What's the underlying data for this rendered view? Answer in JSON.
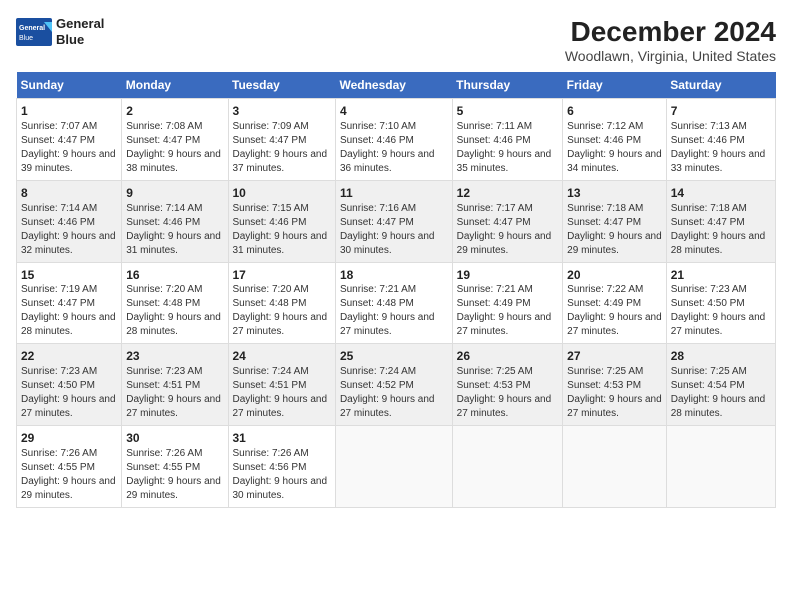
{
  "logo": {
    "line1": "General",
    "line2": "Blue"
  },
  "title": "December 2024",
  "subtitle": "Woodlawn, Virginia, United States",
  "headers": [
    "Sunday",
    "Monday",
    "Tuesday",
    "Wednesday",
    "Thursday",
    "Friday",
    "Saturday"
  ],
  "weeks": [
    [
      {
        "day": 1,
        "sunrise": "7:07 AM",
        "sunset": "4:47 PM",
        "daylight": "9 hours and 39 minutes."
      },
      {
        "day": 2,
        "sunrise": "7:08 AM",
        "sunset": "4:47 PM",
        "daylight": "9 hours and 38 minutes."
      },
      {
        "day": 3,
        "sunrise": "7:09 AM",
        "sunset": "4:47 PM",
        "daylight": "9 hours and 37 minutes."
      },
      {
        "day": 4,
        "sunrise": "7:10 AM",
        "sunset": "4:46 PM",
        "daylight": "9 hours and 36 minutes."
      },
      {
        "day": 5,
        "sunrise": "7:11 AM",
        "sunset": "4:46 PM",
        "daylight": "9 hours and 35 minutes."
      },
      {
        "day": 6,
        "sunrise": "7:12 AM",
        "sunset": "4:46 PM",
        "daylight": "9 hours and 34 minutes."
      },
      {
        "day": 7,
        "sunrise": "7:13 AM",
        "sunset": "4:46 PM",
        "daylight": "9 hours and 33 minutes."
      }
    ],
    [
      {
        "day": 8,
        "sunrise": "7:14 AM",
        "sunset": "4:46 PM",
        "daylight": "9 hours and 32 minutes."
      },
      {
        "day": 9,
        "sunrise": "7:14 AM",
        "sunset": "4:46 PM",
        "daylight": "9 hours and 31 minutes."
      },
      {
        "day": 10,
        "sunrise": "7:15 AM",
        "sunset": "4:46 PM",
        "daylight": "9 hours and 31 minutes."
      },
      {
        "day": 11,
        "sunrise": "7:16 AM",
        "sunset": "4:47 PM",
        "daylight": "9 hours and 30 minutes."
      },
      {
        "day": 12,
        "sunrise": "7:17 AM",
        "sunset": "4:47 PM",
        "daylight": "9 hours and 29 minutes."
      },
      {
        "day": 13,
        "sunrise": "7:18 AM",
        "sunset": "4:47 PM",
        "daylight": "9 hours and 29 minutes."
      },
      {
        "day": 14,
        "sunrise": "7:18 AM",
        "sunset": "4:47 PM",
        "daylight": "9 hours and 28 minutes."
      }
    ],
    [
      {
        "day": 15,
        "sunrise": "7:19 AM",
        "sunset": "4:47 PM",
        "daylight": "9 hours and 28 minutes."
      },
      {
        "day": 16,
        "sunrise": "7:20 AM",
        "sunset": "4:48 PM",
        "daylight": "9 hours and 28 minutes."
      },
      {
        "day": 17,
        "sunrise": "7:20 AM",
        "sunset": "4:48 PM",
        "daylight": "9 hours and 27 minutes."
      },
      {
        "day": 18,
        "sunrise": "7:21 AM",
        "sunset": "4:48 PM",
        "daylight": "9 hours and 27 minutes."
      },
      {
        "day": 19,
        "sunrise": "7:21 AM",
        "sunset": "4:49 PM",
        "daylight": "9 hours and 27 minutes."
      },
      {
        "day": 20,
        "sunrise": "7:22 AM",
        "sunset": "4:49 PM",
        "daylight": "9 hours and 27 minutes."
      },
      {
        "day": 21,
        "sunrise": "7:23 AM",
        "sunset": "4:50 PM",
        "daylight": "9 hours and 27 minutes."
      }
    ],
    [
      {
        "day": 22,
        "sunrise": "7:23 AM",
        "sunset": "4:50 PM",
        "daylight": "9 hours and 27 minutes."
      },
      {
        "day": 23,
        "sunrise": "7:23 AM",
        "sunset": "4:51 PM",
        "daylight": "9 hours and 27 minutes."
      },
      {
        "day": 24,
        "sunrise": "7:24 AM",
        "sunset": "4:51 PM",
        "daylight": "9 hours and 27 minutes."
      },
      {
        "day": 25,
        "sunrise": "7:24 AM",
        "sunset": "4:52 PM",
        "daylight": "9 hours and 27 minutes."
      },
      {
        "day": 26,
        "sunrise": "7:25 AM",
        "sunset": "4:53 PM",
        "daylight": "9 hours and 27 minutes."
      },
      {
        "day": 27,
        "sunrise": "7:25 AM",
        "sunset": "4:53 PM",
        "daylight": "9 hours and 27 minutes."
      },
      {
        "day": 28,
        "sunrise": "7:25 AM",
        "sunset": "4:54 PM",
        "daylight": "9 hours and 28 minutes."
      }
    ],
    [
      {
        "day": 29,
        "sunrise": "7:26 AM",
        "sunset": "4:55 PM",
        "daylight": "9 hours and 29 minutes."
      },
      {
        "day": 30,
        "sunrise": "7:26 AM",
        "sunset": "4:55 PM",
        "daylight": "9 hours and 29 minutes."
      },
      {
        "day": 31,
        "sunrise": "7:26 AM",
        "sunset": "4:56 PM",
        "daylight": "9 hours and 30 minutes."
      },
      null,
      null,
      null,
      null
    ]
  ]
}
